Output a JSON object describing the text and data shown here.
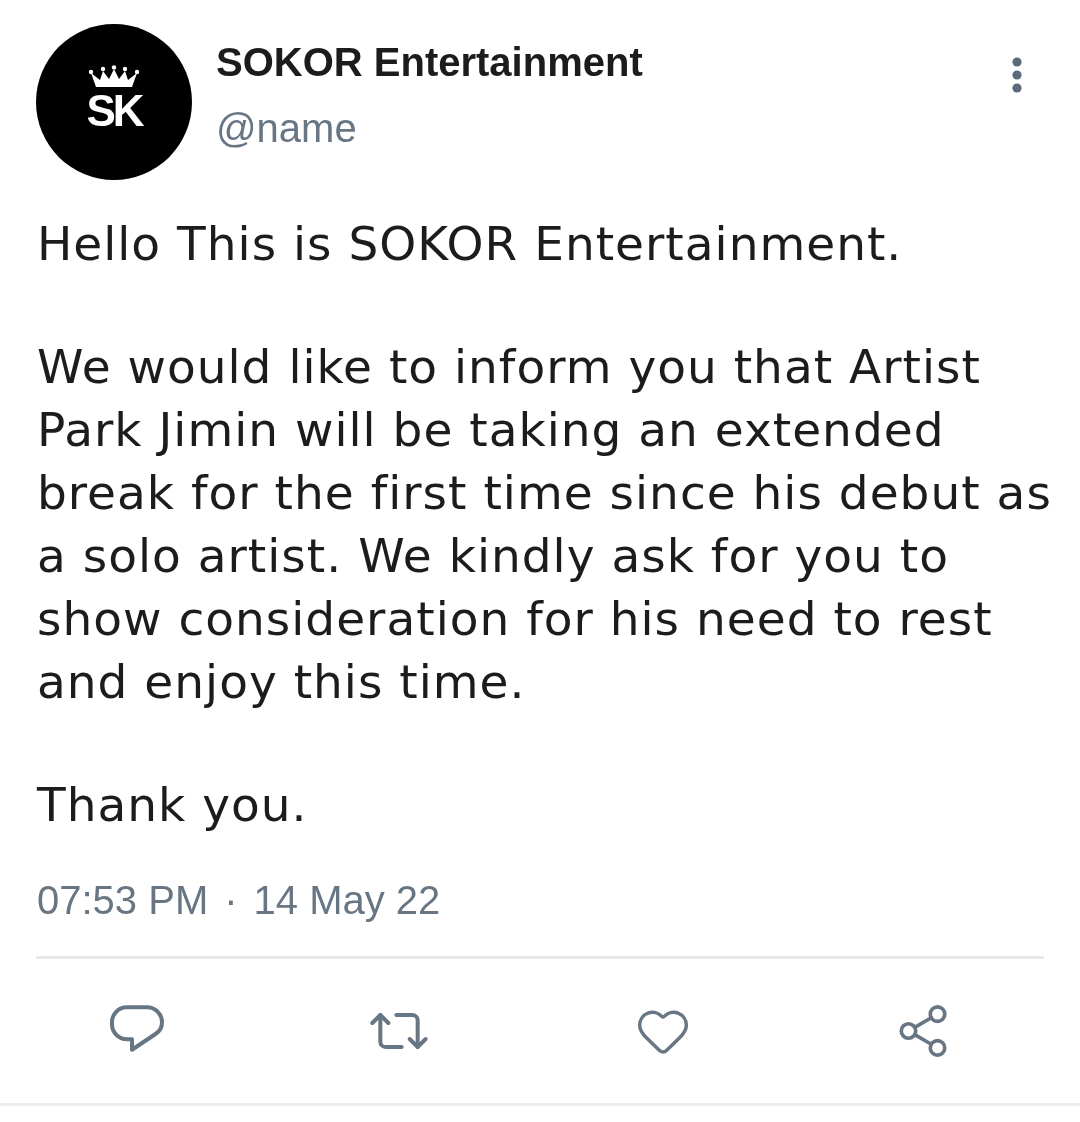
{
  "author": {
    "avatar": {
      "monogram": "SK"
    },
    "name": "SOKOR Entertainment",
    "handle": "@name"
  },
  "post": {
    "paragraphs": [
      "Hello This is SOKOR Entertainment.",
      "We would like to inform you that Artist Park Jimin will be taking an extended break for the first time since his debut as a solo artist. We kindly ask for you to show consideration for his need to rest and enjoy this time.",
      "Thank you."
    ]
  },
  "timestamp": {
    "time": "07:53 PM",
    "separator": "·",
    "date": "14 May 22"
  },
  "actions": [
    {
      "kind": "reply"
    },
    {
      "kind": "retweet"
    },
    {
      "kind": "like"
    },
    {
      "kind": "share"
    }
  ]
}
